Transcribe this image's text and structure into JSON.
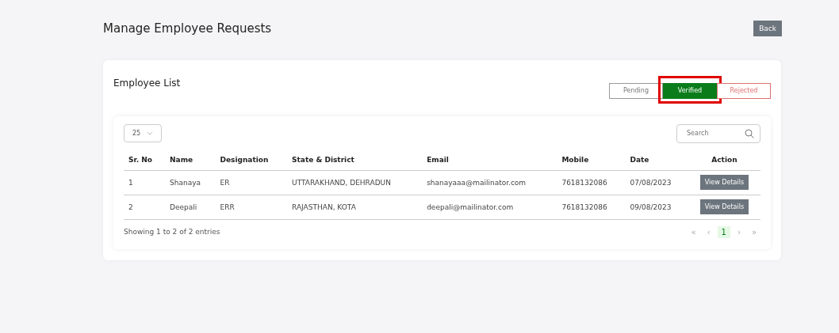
{
  "page": {
    "title": "Manage Employee Requests",
    "back_button": "Back"
  },
  "card": {
    "title": "Employee List",
    "filters": [
      {
        "label": "Pending",
        "kind": "pending",
        "selected": false,
        "highlighted": false
      },
      {
        "label": "Verified",
        "kind": "verified",
        "selected": true,
        "highlighted": true
      },
      {
        "label": "Rejected",
        "kind": "rejected",
        "selected": false,
        "highlighted": false
      }
    ]
  },
  "table": {
    "page_size": "25",
    "search": {
      "placeholder": "Search"
    },
    "columns": [
      "Sr. No",
      "Name",
      "Designation",
      "State & District",
      "Email",
      "Mobile",
      "Date",
      "Action"
    ],
    "rows": [
      {
        "cells": [
          "1",
          "Shanaya",
          "ER",
          "UTTARAKHAND, DEHRADUN",
          "shanayaaa@mailinator.com",
          "7618132086",
          "07/08/2023"
        ],
        "action": "View Details"
      },
      {
        "cells": [
          "2",
          "Deepali",
          "ERR",
          "RAJASTHAN, KOTA",
          "deepali@mailinator.com",
          "7618132086",
          "09/08/2023"
        ],
        "action": "View Details"
      }
    ],
    "info": "Showing 1 to 2 of 2 entries",
    "pagination": [
      {
        "label": "«",
        "selected": false
      },
      {
        "label": "‹",
        "selected": false
      },
      {
        "label": "1",
        "selected": true
      },
      {
        "label": "›",
        "selected": false
      },
      {
        "label": "»",
        "selected": false
      }
    ]
  }
}
